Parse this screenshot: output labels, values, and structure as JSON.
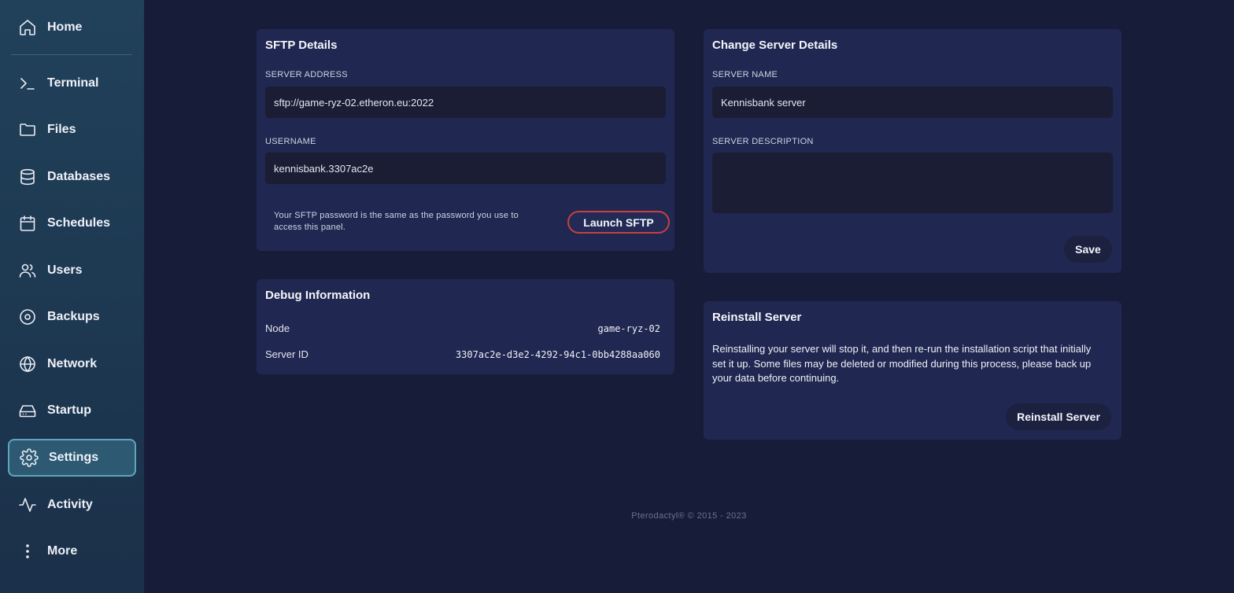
{
  "sidebar": {
    "items": [
      {
        "label": "Home",
        "icon": "home-icon"
      },
      {
        "label": "Terminal",
        "icon": "terminal-icon"
      },
      {
        "label": "Files",
        "icon": "folder-icon"
      },
      {
        "label": "Databases",
        "icon": "database-icon"
      },
      {
        "label": "Schedules",
        "icon": "calendar-icon"
      },
      {
        "label": "Users",
        "icon": "users-icon"
      },
      {
        "label": "Backups",
        "icon": "backup-disc-icon"
      },
      {
        "label": "Network",
        "icon": "globe-icon"
      },
      {
        "label": "Startup",
        "icon": "hard-drive-icon"
      },
      {
        "label": "Settings",
        "icon": "gear-icon",
        "active": true
      },
      {
        "label": "Activity",
        "icon": "activity-pulse-icon"
      },
      {
        "label": "More",
        "icon": "more-vertical-icon"
      }
    ]
  },
  "sftp": {
    "title": "SFTP Details",
    "address_label": "SERVER ADDRESS",
    "address_value": "sftp://game-ryz-02.etheron.eu:2022",
    "username_label": "USERNAME",
    "username_value": "kennisbank.3307ac2e",
    "hint": "Your SFTP password is the same as the password you use to access this panel.",
    "launch_label": "Launch SFTP"
  },
  "debug": {
    "title": "Debug Information",
    "rows": [
      {
        "key": "Node",
        "value": "game-ryz-02"
      },
      {
        "key": "Server ID",
        "value": "3307ac2e-d3e2-4292-94c1-0bb4288aa060"
      }
    ]
  },
  "change_details": {
    "title": "Change Server Details",
    "name_label": "SERVER NAME",
    "name_value": "Kennisbank server",
    "description_label": "SERVER DESCRIPTION",
    "description_value": "",
    "save_label": "Save"
  },
  "reinstall": {
    "title": "Reinstall Server",
    "text": "Reinstalling your server will stop it, and then re-run the installation script that initially set it up. Some files may be deleted or modified during this process, please back up your data before continuing.",
    "button_label": "Reinstall Server"
  },
  "footer": {
    "text": "Pterodactyl® © 2015 - 2023"
  },
  "colors": {
    "background": "#171d38",
    "card": "#202750",
    "input": "#1a1d33",
    "active_nav": "#2d5a72",
    "launch_outline": "#c8403f"
  }
}
